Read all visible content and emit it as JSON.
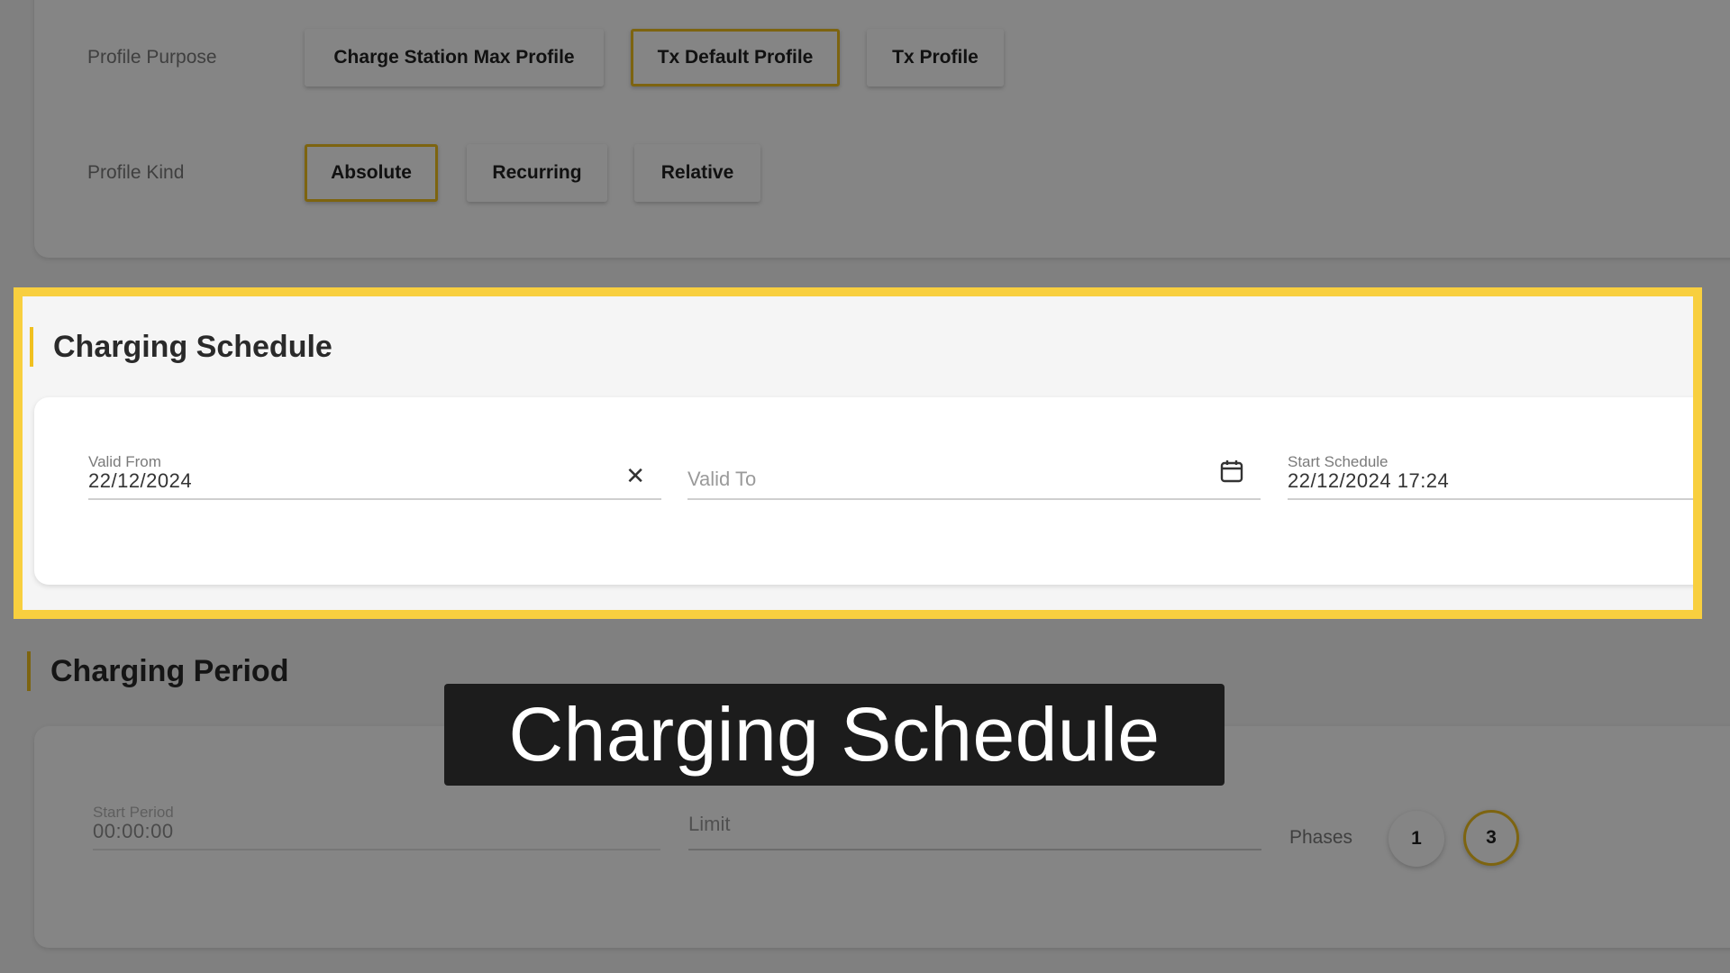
{
  "profile_purpose": {
    "label": "Profile Purpose",
    "options": [
      "Charge Station Max Profile",
      "Tx Default Profile",
      "Tx Profile"
    ],
    "selected": "Tx Default Profile"
  },
  "profile_kind": {
    "label": "Profile Kind",
    "options": [
      "Absolute",
      "Recurring",
      "Relative"
    ],
    "selected": "Absolute"
  },
  "charging_schedule": {
    "title": "Charging Schedule",
    "valid_from": {
      "label": "Valid From",
      "value": "22/12/2024"
    },
    "valid_to": {
      "placeholder": "Valid To"
    },
    "start_schedule": {
      "label": "Start Schedule",
      "value": "22/12/2024 17:24"
    }
  },
  "charging_period": {
    "title": "Charging Period",
    "start_period": {
      "label": "Start Period",
      "value": "00:00:00"
    },
    "limit": {
      "placeholder": "Limit"
    },
    "phases": {
      "label": "Phases",
      "options": [
        "1",
        "3"
      ],
      "selected": "3"
    }
  },
  "caption": "Charging Schedule",
  "colors": {
    "accent": "#f0c020",
    "highlight_border": "#f8cf3f",
    "caption_bg": "#1c1c1c"
  },
  "icons": {
    "clear": "close-icon",
    "calendar": "calendar-icon"
  }
}
